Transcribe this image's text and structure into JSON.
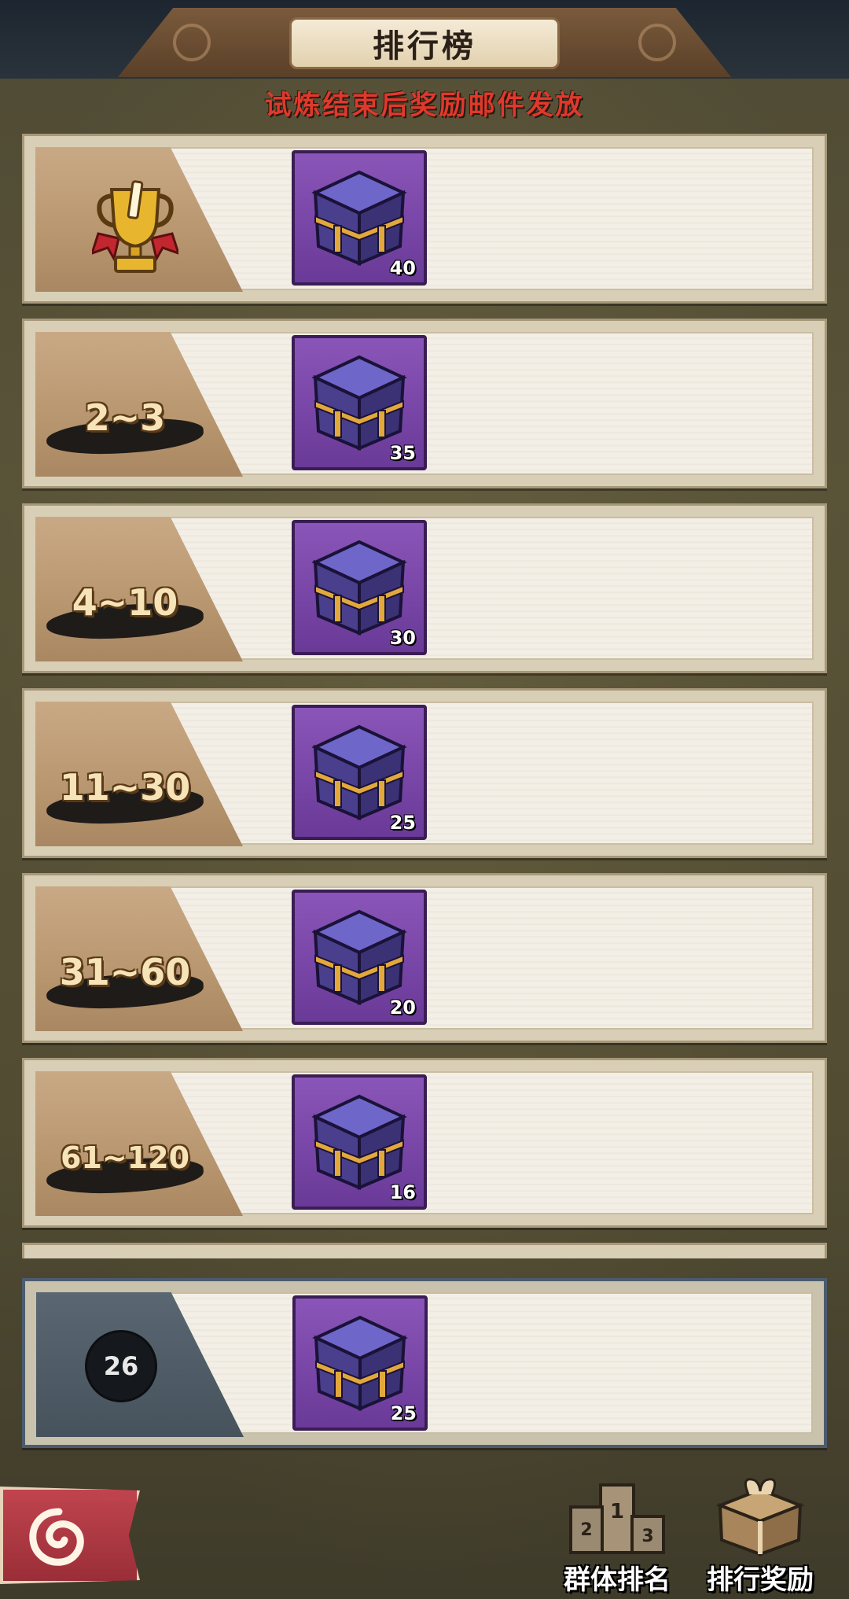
{
  "header": {
    "title": "排行榜",
    "subtitle": "试炼结束后奖励邮件发放"
  },
  "ranks": [
    {
      "rank_label": "",
      "icon": "gold-trophy-icon",
      "reward_icon": "purple-gift-box-icon",
      "reward_count": "40"
    },
    {
      "rank_label": "2~3",
      "reward_icon": "purple-gift-box-icon",
      "reward_count": "35"
    },
    {
      "rank_label": "4~10",
      "reward_icon": "purple-gift-box-icon",
      "reward_count": "30"
    },
    {
      "rank_label": "11~30",
      "reward_icon": "purple-gift-box-icon",
      "reward_count": "25"
    },
    {
      "rank_label": "31~60",
      "reward_icon": "purple-gift-box-icon",
      "reward_count": "20"
    },
    {
      "rank_label": "61~120",
      "reward_icon": "purple-gift-box-icon",
      "reward_count": "16"
    }
  ],
  "my_rank": {
    "rank": "26",
    "reward_icon": "purple-gift-box-icon",
    "reward_count": "25"
  },
  "bottom_nav": {
    "back_icon": "swirl-back-icon",
    "group_ranking_label": "群体排名",
    "group_ranking_icon": "podium-icon",
    "rank_rewards_label": "排行奖励",
    "rank_rewards_icon": "gift-crate-icon"
  },
  "colors": {
    "subtitle_red": "#e0392c",
    "reward_purple": "#7a48a8",
    "rank_tan": "#b8966f",
    "my_rank_slate": "#4c5c6e"
  }
}
